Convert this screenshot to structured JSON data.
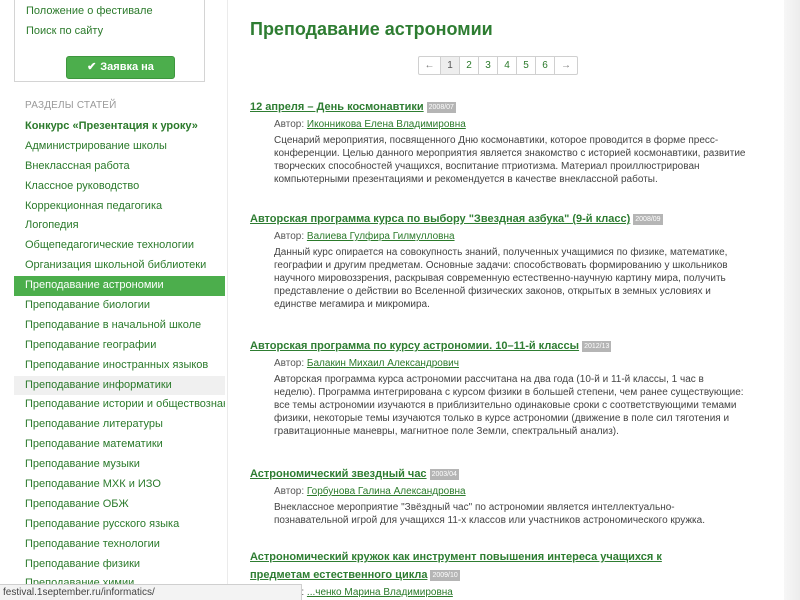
{
  "top_links": [
    "Положение о фестивале",
    "Поиск по сайту"
  ],
  "apply_button": "Заявка на участие",
  "section_heading": "РАЗДЕЛЫ СТАТЕЙ",
  "nav": [
    {
      "label": "Конкурс «Презентация к уроку»",
      "state": "bold"
    },
    {
      "label": "Администрирование школы",
      "state": ""
    },
    {
      "label": "Внеклассная работа",
      "state": ""
    },
    {
      "label": "Классное руководство",
      "state": ""
    },
    {
      "label": "Коррекционная педагогика",
      "state": ""
    },
    {
      "label": "Логопедия",
      "state": ""
    },
    {
      "label": "Общепедагогические технологии",
      "state": ""
    },
    {
      "label": "Организация школьной библиотеки",
      "state": ""
    },
    {
      "label": "Преподавание астрономии",
      "state": "active"
    },
    {
      "label": "Преподавание биологии",
      "state": ""
    },
    {
      "label": "Преподавание в начальной школе",
      "state": ""
    },
    {
      "label": "Преподавание географии",
      "state": ""
    },
    {
      "label": "Преподавание иностранных языков",
      "state": ""
    },
    {
      "label": "Преподавание информатики",
      "state": "hover"
    },
    {
      "label": "Преподавание истории и обществознания",
      "state": ""
    },
    {
      "label": "Преподавание литературы",
      "state": ""
    },
    {
      "label": "Преподавание математики",
      "state": ""
    },
    {
      "label": "Преподавание музыки",
      "state": ""
    },
    {
      "label": "Преподавание МХК и ИЗО",
      "state": ""
    },
    {
      "label": "Преподавание ОБЖ",
      "state": ""
    },
    {
      "label": "Преподавание русского языка",
      "state": ""
    },
    {
      "label": "Преподавание технологии",
      "state": ""
    },
    {
      "label": "Преподавание физики",
      "state": ""
    },
    {
      "label": "Преподавание химии",
      "state": ""
    }
  ],
  "page_title": "Преподавание астрономии",
  "pager": {
    "prev": "←",
    "next": "→",
    "pages": [
      "1",
      "2",
      "3",
      "4",
      "5",
      "6"
    ],
    "current": "1"
  },
  "author_prefix": "Автор:",
  "articles": [
    {
      "title": "12 апреля – День космонавтики",
      "date": "2008/07",
      "author": "Иконникова Елена Владимировна",
      "description": "Сценарий мероприятия, посвященного Дню космонавтики, которое проводится в форме пресс-конференции. Целью данного мероприятия является знакомство с историей космонавтики, развитие творческих способностей учащихся, воспитание птриотизма. Материал проиллюстрирован компьютерными презентациями и рекомендуется в качестве внеклассной работы."
    },
    {
      "title": "Авторская программа курса по выбору \"Звездная азбука\" (9-й класс)",
      "date": "2008/09",
      "author": "Валиева Гулфира Гилмулловна",
      "description": "Данный курс опирается на совокупность знаний, полученных учащимися по физике, математике, географии и другим предметам. Основные задачи: способствовать формированию у школьников научного мировоззрения, раскрывая современную естественно-научную картину мира, получить представление о действии во Вселенной физических законов, открытых в земных условиях и единстве мегамира и микромира."
    },
    {
      "title": "Авторская программа по курсу астрономии. 10–11-й классы",
      "date": "2012/13",
      "author": "Балакин Михаил Александрович",
      "description": "Авторская программа курса астрономии рассчитана на два года (10-й и 11-й классы, 1 час в неделю). Программа интегрирована с курсом физики в большей степени, чем ранее существующие: все темы астрономии изучаются в приблизительно одинаковые сроки с соответствующими темами физики, некоторые темы изучаются только в курсе астрономии (движение в поле сил тяготения и гравитационные маневры, магнитное поле Земли, спектральный анализ)."
    },
    {
      "title": "Астрономический звездный час",
      "date": "2003/04",
      "author": "Горбунова Галина Александровна",
      "description": "Внеклассное мероприятие \"Звёздный час\" по астрономии является интеллектуально-познавательной игрой для учащихся 11-х классов или участников астрономического кружка."
    },
    {
      "title": "Астрономический кружок как инструмент повышения интереса учащихся к предметам естественного цикла",
      "date": "2009/10",
      "author": "...ченко Марина Владимировна",
      "description": ""
    }
  ],
  "status_url": "festival.1september.ru/informatics/"
}
